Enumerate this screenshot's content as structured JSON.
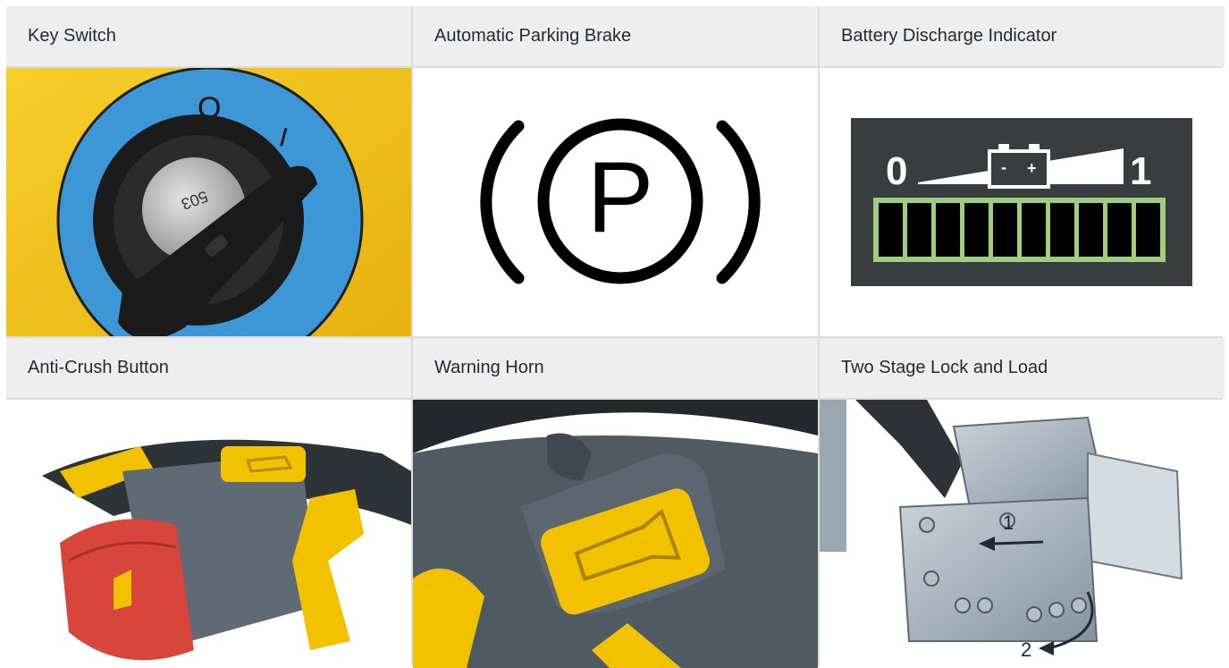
{
  "headers": {
    "key_switch": "Key Switch",
    "parking_brake": "Automatic Parking Brake",
    "battery_indicator": "Battery Discharge Indicator",
    "anti_crush": "Anti-Crush Button",
    "warning_horn": "Warning Horn",
    "lock_and_load": "Two Stage Lock and Load"
  },
  "key_switch": {
    "off_mark": "O",
    "on_mark": "I",
    "key_code": "503"
  },
  "parking_brake": {
    "letter": "P"
  },
  "battery_indicator": {
    "min_label": "0",
    "max_label": "1",
    "segments": 10,
    "minus": "-",
    "plus": "+"
  },
  "lock_and_load": {
    "step_1": "1",
    "step_2": "2"
  },
  "colors": {
    "header_bg": "#eeeeee",
    "grid_line": "#dcdcdc",
    "key_bg_yellow": "#f3c21a",
    "key_ring_blue": "#3d97d6",
    "battery_panel": "#3a3d3f",
    "battery_segment": "#9fcf7c",
    "handle_yellow": "#f2c200",
    "handle_grey": "#5f6a74",
    "anti_crush_red": "#d8453a"
  }
}
